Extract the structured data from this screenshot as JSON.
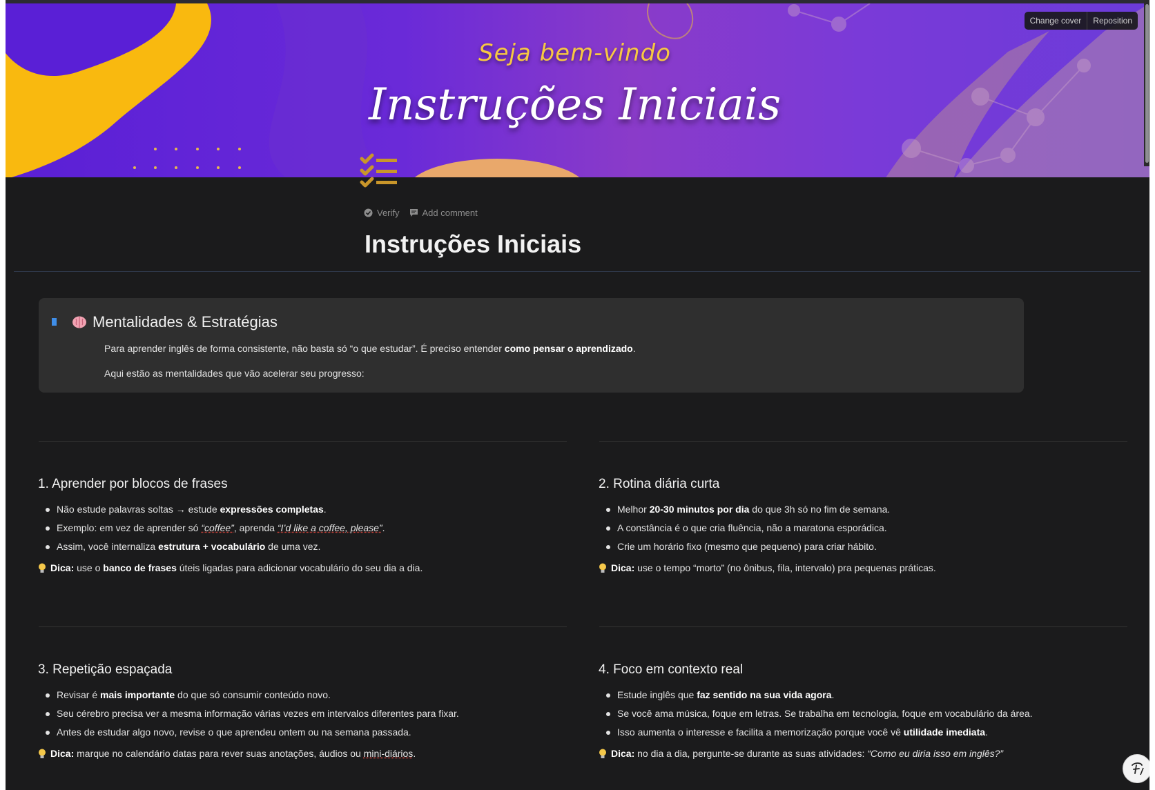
{
  "cover": {
    "subtitle": "Seja bem-vindo",
    "title": "Instruções Iniciais",
    "change_cover": "Change cover",
    "reposition": "Reposition"
  },
  "meta": {
    "verify": "Verify",
    "add_comment": "Add comment"
  },
  "page": {
    "title": "Instruções Iniciais"
  },
  "callout": {
    "heading": "Mentalidades & Estratégias",
    "p1_a": "Para aprender inglês de forma consistente, não basta só “o que estudar”. É preciso entender ",
    "p1_b": "como pensar o aprendizado",
    "p1_c": ".",
    "p2": "Aqui estão as mentalidades que vão acelerar seu progresso:"
  },
  "sections": [
    {
      "title": "1. Aprender por blocos de frases",
      "b1_a": "Não estude palavras soltas → estude ",
      "b1_b": "expressões completas",
      "b1_c": ".",
      "b2_a": "Exemplo: em vez de aprender só ",
      "b2_b": "“coffee”",
      "b2_c": ", aprenda ",
      "b2_d": "“I’d like a coffee, please”",
      "b2_e": ".",
      "b3_a": "Assim, você internaliza ",
      "b3_b": "estrutura + vocabulário",
      "b3_c": " de uma vez.",
      "tip_label": "Dica:",
      "tip_a": " use o ",
      "tip_b": "banco de frases",
      "tip_c": " úteis ligadas para adicionar vocabulário do seu dia a dia."
    },
    {
      "title": "2. Rotina diária curta",
      "b1_a": "Melhor ",
      "b1_b": "20-30 minutos por dia",
      "b1_c": " do que 3h só no fim de semana.",
      "b2": "A constância é o que cria fluência, não a maratona esporádica.",
      "b3": "Crie um horário fixo (mesmo que pequeno) para criar hábito.",
      "tip_label": "Dica:",
      "tip": " use o tempo “morto” (no ônibus, fila, intervalo) pra pequenas práticas."
    },
    {
      "title": "3. Repetição espaçada",
      "b1_a": "Revisar é ",
      "b1_b": "mais importante",
      "b1_c": " do que só consumir conteúdo novo.",
      "b2": "Seu cérebro precisa ver a mesma informação várias vezes em intervalos diferentes para fixar.",
      "b3": "Antes de estudar algo novo, revise o que aprendeu ontem ou na semana passada.",
      "tip_label": "Dica:",
      "tip_a": " marque no calendário datas para rever suas anotações, áudios ou ",
      "tip_b": "mini-diários",
      "tip_c": "."
    },
    {
      "title": "4. Foco em contexto real",
      "b1_a": "Estude inglês que ",
      "b1_b": "faz sentido na sua vida agora",
      "b1_c": ".",
      "b2": "Se você ama música, foque em letras. Se trabalha em tecnologia, foque em vocabulário da área.",
      "b3_a": "Isso aumenta o interesse e facilita a memorização porque você vê ",
      "b3_b": "utilidade imediata",
      "b3_c": ".",
      "tip_label": "Dica:",
      "tip_a": " no dia a dia, pergunte-se durante as suas atividades: ",
      "tip_b": "“Como eu diria isso em inglês?”"
    }
  ],
  "icons": {
    "page_icon": "checklist-icon",
    "callout_icon": "brain-icon",
    "tip_icon": "lightbulb-icon"
  },
  "colors": {
    "background": "#1b1b1c",
    "callout": "#2f2f2f",
    "accent_gold": "#c9962a",
    "cover_purple": "#6a2ad8"
  }
}
